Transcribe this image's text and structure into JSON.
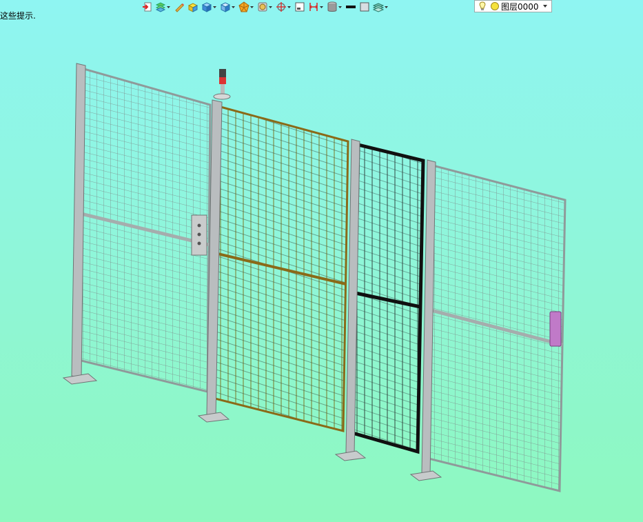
{
  "hint_text": "这些提示.",
  "toolbar": {
    "buttons": [
      {
        "icon": "exit-icon",
        "dropdown": false
      },
      {
        "icon": "layers-stack-icon",
        "dropdown": true
      },
      {
        "icon": "pencil-icon",
        "dropdown": false
      },
      {
        "icon": "yellow-box-icon",
        "dropdown": false
      },
      {
        "icon": "blue-cube-icon",
        "dropdown": true
      },
      {
        "icon": "blue-cube-view-icon",
        "dropdown": true
      },
      {
        "icon": "orange-polygon-icon",
        "dropdown": true
      },
      {
        "icon": "render-style-icon",
        "dropdown": true
      },
      {
        "icon": "crosshair-move-icon",
        "dropdown": true
      },
      {
        "icon": "viewport-frame-icon",
        "dropdown": false
      },
      {
        "icon": "dimension-icon",
        "dropdown": true
      },
      {
        "icon": "cylinder-icon",
        "dropdown": true
      },
      {
        "icon": "black-line-icon",
        "dropdown": false
      },
      {
        "icon": "gray-fill-icon",
        "dropdown": false
      },
      {
        "icon": "layer-sheets-icon",
        "dropdown": true
      }
    ]
  },
  "layer_combo": {
    "value": "图层0000",
    "icons": [
      "lightbulb-icon",
      "yellow-circle-icon"
    ]
  },
  "colors": {
    "background_top": "#8ff5f2",
    "background_bottom": "#8ef8bf",
    "post": "#b9bdbf",
    "door_frame": "#8a6a18",
    "door_mesh": "#8a7a10",
    "black_door_frame": "#101010",
    "handle": "#c07ac8"
  }
}
